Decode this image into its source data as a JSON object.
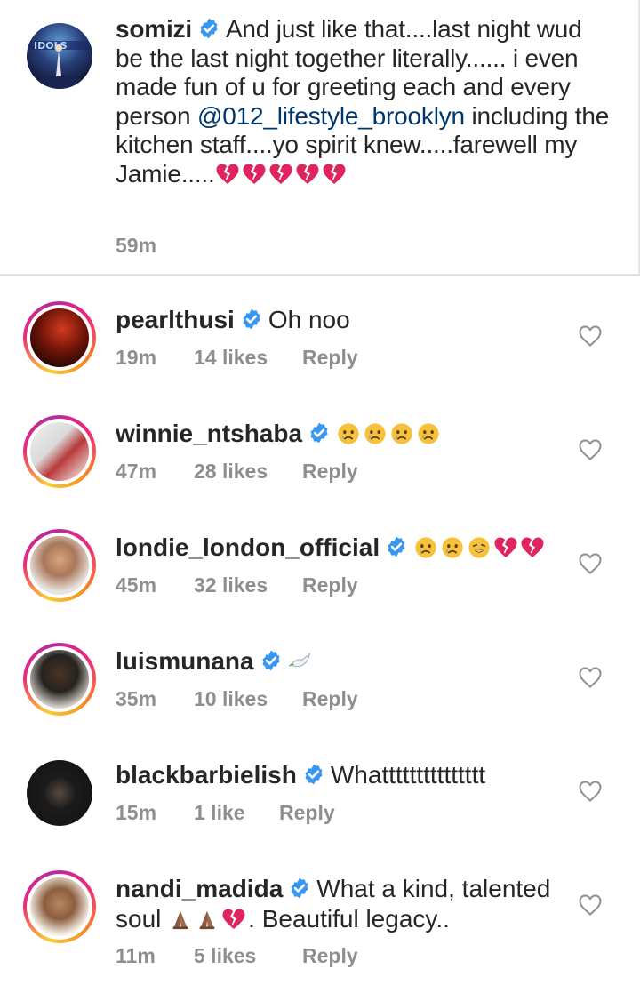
{
  "caption": {
    "username": "somizi",
    "text_1": "And just like that....last night wud be the last night together literally...... i even made fun of u for greeting each and every person ",
    "mention": "@012_lifestyle_brooklyn",
    "text_2": " including the kitchen staff....yo spirit knew.....farewell my Jamie.....",
    "time": "59m",
    "emoji": [
      "broken-heart",
      "broken-heart",
      "broken-heart",
      "broken-heart",
      "broken-heart"
    ]
  },
  "comments": [
    {
      "username": "pearlthusi",
      "text": "Oh noo",
      "time": "19m",
      "likes": "14 likes",
      "reply": "Reply",
      "emoji": []
    },
    {
      "username": "winnie_ntshaba",
      "text": "",
      "time": "47m",
      "likes": "28 likes",
      "reply": "Reply",
      "emoji": [
        "crying-face",
        "crying-face",
        "crying-face",
        "crying-face"
      ]
    },
    {
      "username": "londie_london_official",
      "text": "",
      "time": "45m",
      "likes": "32 likes",
      "reply": "Reply",
      "emoji": [
        "crying-face",
        "crying-face",
        "weary-face",
        "broken-heart",
        "broken-heart"
      ]
    },
    {
      "username": "luismunana",
      "text": "",
      "time": "35m",
      "likes": "10 likes",
      "reply": "Reply",
      "emoji": [
        "dove"
      ]
    },
    {
      "username": "blackbarbielish",
      "text": "Whattttttttttttttt",
      "time": "15m",
      "likes": "1 like",
      "reply": "Reply",
      "emoji": []
    },
    {
      "username": "nandi_madida",
      "text": "What a kind, talented soul",
      "text_after": ". Beautiful legacy..",
      "time": "11m",
      "likes": "5 likes",
      "reply": "Reply",
      "emoji": [
        "folded-hands",
        "folded-hands",
        "broken-heart"
      ]
    }
  ],
  "colors": {
    "text": "#262626",
    "meta": "#8e8e8e",
    "mention": "#00376b",
    "verified": "#3897f0",
    "broken_heart": "#e0245e"
  }
}
